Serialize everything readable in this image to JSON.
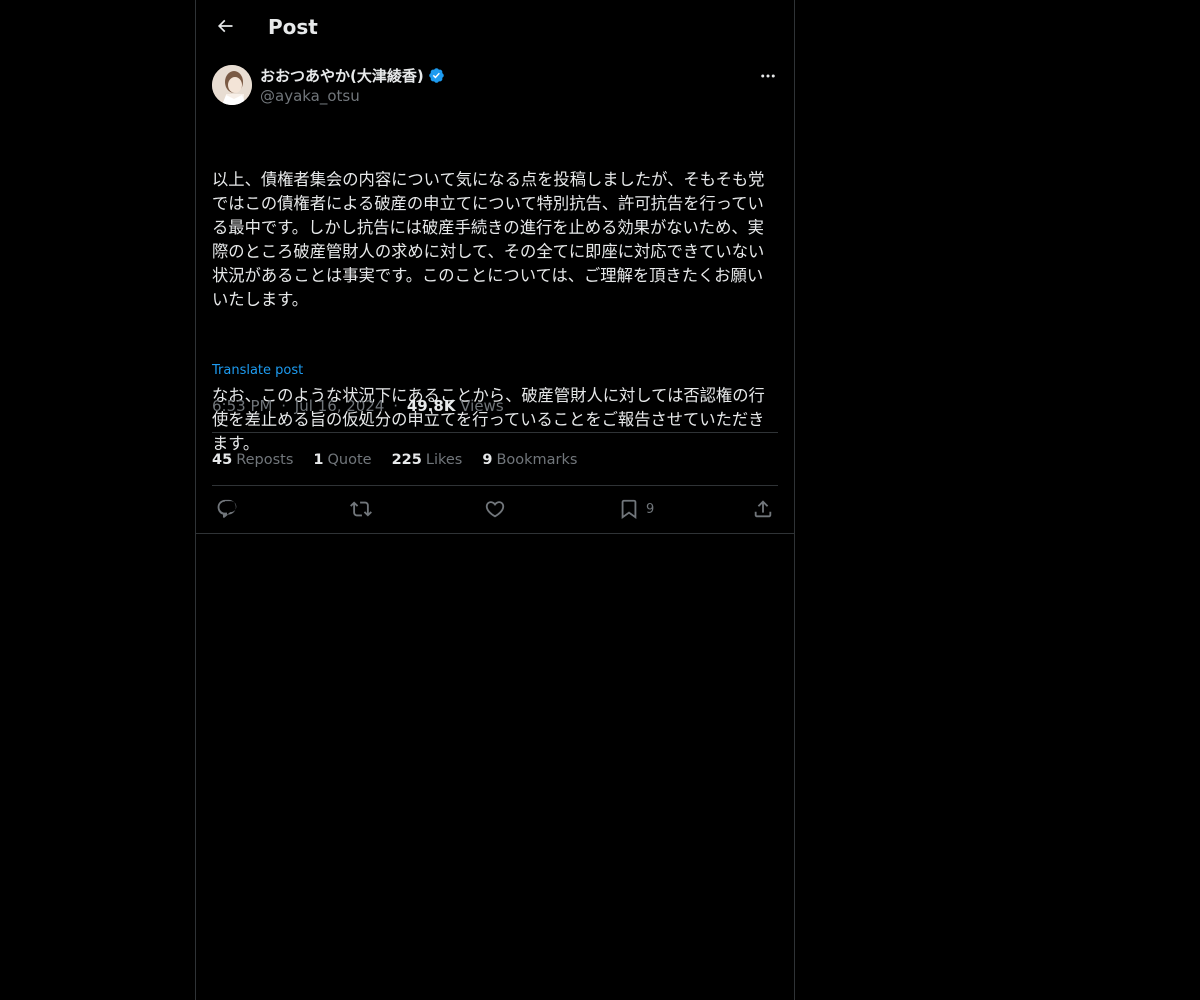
{
  "header": {
    "title": "Post",
    "back_icon": "arrow-left-icon"
  },
  "post": {
    "author": {
      "name": "おおつあやか(大津綾香)",
      "handle": "@ayaka_otsu",
      "verified": true,
      "verified_color": "#1d9bf0"
    },
    "more_icon": "more-horizontal-icon",
    "paragraphs": [
      "以上、債権者集会の内容について気になる点を投稿しましたが、そもそも党ではこの債権者による破産の申立てについて特別抗告、許可抗告を行っている最中です。しかし抗告には破産手続きの進行を止める効果がないため、実際のところ破産管財人の求めに対して、その全てに即座に対応できていない状況があることは事実です。このことについては、ご理解を頂きたくお願いいたします。",
      "なお、このような状況下にあることから、破産管財人に対しては否認権の行使を差止める旨の仮処分の申立てを行っていることをご報告させていただきます。"
    ],
    "translate_label": "Translate post",
    "time": "6:53 PM",
    "date": "Jul 16, 2024",
    "views_count": "49.8K",
    "views_label": "Views",
    "separator": "·"
  },
  "stats": {
    "reposts": {
      "count": "45",
      "label": "Reposts"
    },
    "quotes": {
      "count": "1",
      "label": "Quote"
    },
    "likes": {
      "count": "225",
      "label": "Likes"
    },
    "bookmarks": {
      "count": "9",
      "label": "Bookmarks"
    }
  },
  "actions": {
    "reply_icon": "reply-icon",
    "repost_icon": "repost-icon",
    "like_icon": "heart-icon",
    "bookmark_icon": "bookmark-icon",
    "bookmark_count": "9",
    "share_icon": "share-icon"
  },
  "colors": {
    "background": "#000000",
    "text": "#e7e9ea",
    "muted": "#71767b",
    "link": "#1d9bf0",
    "border": "#2f3336"
  }
}
